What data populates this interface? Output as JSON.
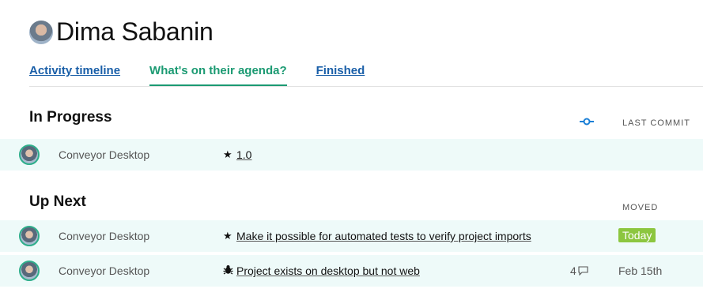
{
  "header": {
    "name": "Dima Sabanin"
  },
  "tabs": [
    {
      "label": "Activity timeline"
    },
    {
      "label": "What's on their agenda?"
    },
    {
      "label": "Finished"
    }
  ],
  "in_progress": {
    "title": "In Progress",
    "column_label": "LAST COMMIT",
    "rows": [
      {
        "project": "Conveyor Desktop",
        "icon": "star-icon",
        "text": "1.0"
      }
    ]
  },
  "up_next": {
    "title": "Up Next",
    "column_label": "MOVED",
    "rows": [
      {
        "project": "Conveyor Desktop",
        "icon": "star-icon",
        "text": "Make it possible for automated tests to verify project imports",
        "moved": "Today"
      },
      {
        "project": "Conveyor Desktop",
        "icon": "bug-icon",
        "text": "Project exists on desktop but not web",
        "comments": "4",
        "moved": "Feb 15th"
      }
    ]
  },
  "colors": {
    "accent": "#1b9a72",
    "link": "#1a5fa8",
    "row_bg": "#eefaf9",
    "today": "#8cc63f"
  }
}
